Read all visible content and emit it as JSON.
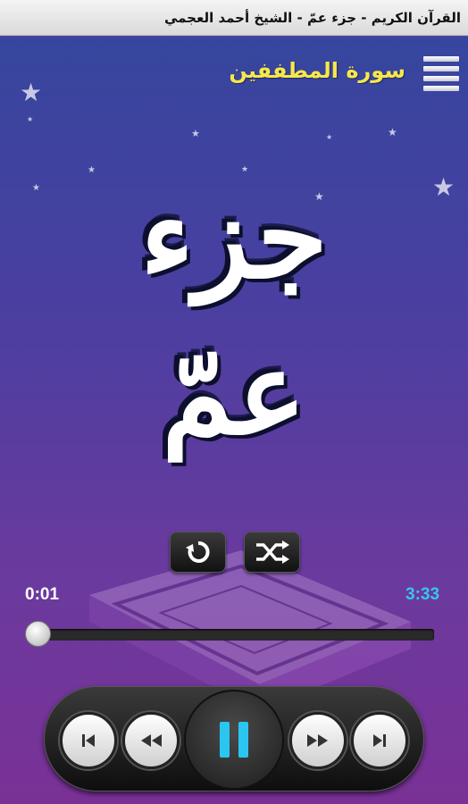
{
  "window": {
    "title": "القرآن الكريم - جزء عمّ - الشيخ أحمد العجمي"
  },
  "header": {
    "surah_name": "سورة المطففين",
    "menu_icon": "menu-icon"
  },
  "logo": {
    "line1": "جزء",
    "line2": "عمّ"
  },
  "controls": {
    "repeat_icon": "repeat-icon",
    "shuffle_icon": "shuffle-icon"
  },
  "progress": {
    "current_time": "0:01",
    "total_time": "3:33",
    "fraction": 0.005
  },
  "player": {
    "buttons": [
      "skip-previous-icon",
      "rewind-icon",
      "pause-icon",
      "fast-forward-icon",
      "skip-next-icon"
    ]
  },
  "colors": {
    "surah_text": "#f6e84a",
    "total_time": "#35c6ee",
    "current_time": "#ffffff",
    "pause_accent": "#2bc6f0"
  }
}
